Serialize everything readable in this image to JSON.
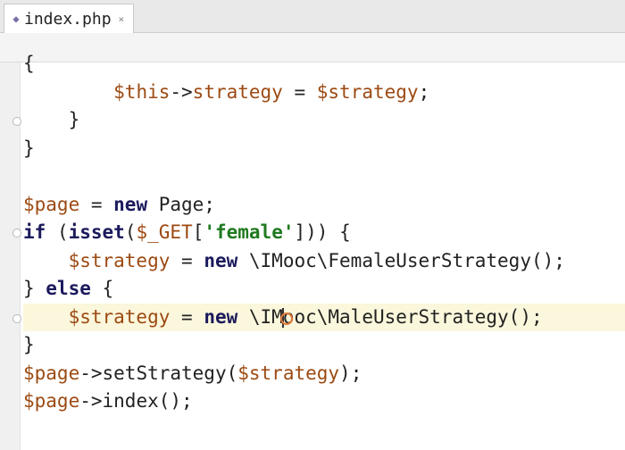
{
  "tab": {
    "title": "index.php",
    "close": "×",
    "icon": "php-file-icon"
  },
  "code": [
    [
      {
        "t": "{",
        "c": "plain"
      }
    ],
    [
      {
        "t": "        ",
        "c": "plain"
      },
      {
        "t": "$this",
        "c": "var"
      },
      {
        "t": "->",
        "c": "plain"
      },
      {
        "t": "strategy",
        "c": "var"
      },
      {
        "t": " = ",
        "c": "plain"
      },
      {
        "t": "$strategy",
        "c": "var"
      },
      {
        "t": ";",
        "c": "plain"
      }
    ],
    [
      {
        "t": "    }",
        "c": "plain"
      }
    ],
    [
      {
        "t": "}",
        "c": "plain"
      }
    ],
    [
      {
        "t": "",
        "c": "plain"
      }
    ],
    [
      {
        "t": "$page",
        "c": "var"
      },
      {
        "t": " = ",
        "c": "plain"
      },
      {
        "t": "new",
        "c": "kw"
      },
      {
        "t": " Page;",
        "c": "plain"
      }
    ],
    [
      {
        "t": "if",
        "c": "kw"
      },
      {
        "t": " (",
        "c": "plain"
      },
      {
        "t": "isset",
        "c": "kw"
      },
      {
        "t": "(",
        "c": "plain"
      },
      {
        "t": "$_GET",
        "c": "var"
      },
      {
        "t": "[",
        "c": "plain"
      },
      {
        "t": "'female'",
        "c": "str"
      },
      {
        "t": "])) {",
        "c": "plain"
      }
    ],
    [
      {
        "t": "    ",
        "c": "plain"
      },
      {
        "t": "$strategy",
        "c": "var"
      },
      {
        "t": " = ",
        "c": "plain"
      },
      {
        "t": "new",
        "c": "kw"
      },
      {
        "t": " \\IMooc\\FemaleUserStrategy();",
        "c": "plain"
      }
    ],
    [
      {
        "t": "} ",
        "c": "plain"
      },
      {
        "t": "else",
        "c": "kw"
      },
      {
        "t": " {",
        "c": "plain"
      }
    ],
    [
      {
        "t": "    ",
        "c": "plain"
      },
      {
        "t": "$strategy",
        "c": "var"
      },
      {
        "t": " = ",
        "c": "plain"
      },
      {
        "t": "new",
        "c": "kw"
      },
      {
        "t": " \\IMooc\\MaleUserStrategy();",
        "c": "plain"
      }
    ],
    [
      {
        "t": "}",
        "c": "plain"
      }
    ],
    [
      {
        "t": "$page",
        "c": "var"
      },
      {
        "t": "->",
        "c": "plain"
      },
      {
        "t": "setStrategy",
        "c": "plain"
      },
      {
        "t": "(",
        "c": "plain"
      },
      {
        "t": "$strategy",
        "c": "var"
      },
      {
        "t": ");",
        "c": "plain"
      }
    ],
    [
      {
        "t": "$page",
        "c": "var"
      },
      {
        "t": "->",
        "c": "plain"
      },
      {
        "t": "index",
        "c": "plain"
      },
      {
        "t": "();",
        "c": "plain"
      }
    ]
  ],
  "current_line": 9,
  "caret_column": 23,
  "colors": {
    "keyword": "#1b1a5c",
    "variable": "#9c4a12",
    "string": "#1f7a1f",
    "current_line": "#fbf7dc"
  }
}
